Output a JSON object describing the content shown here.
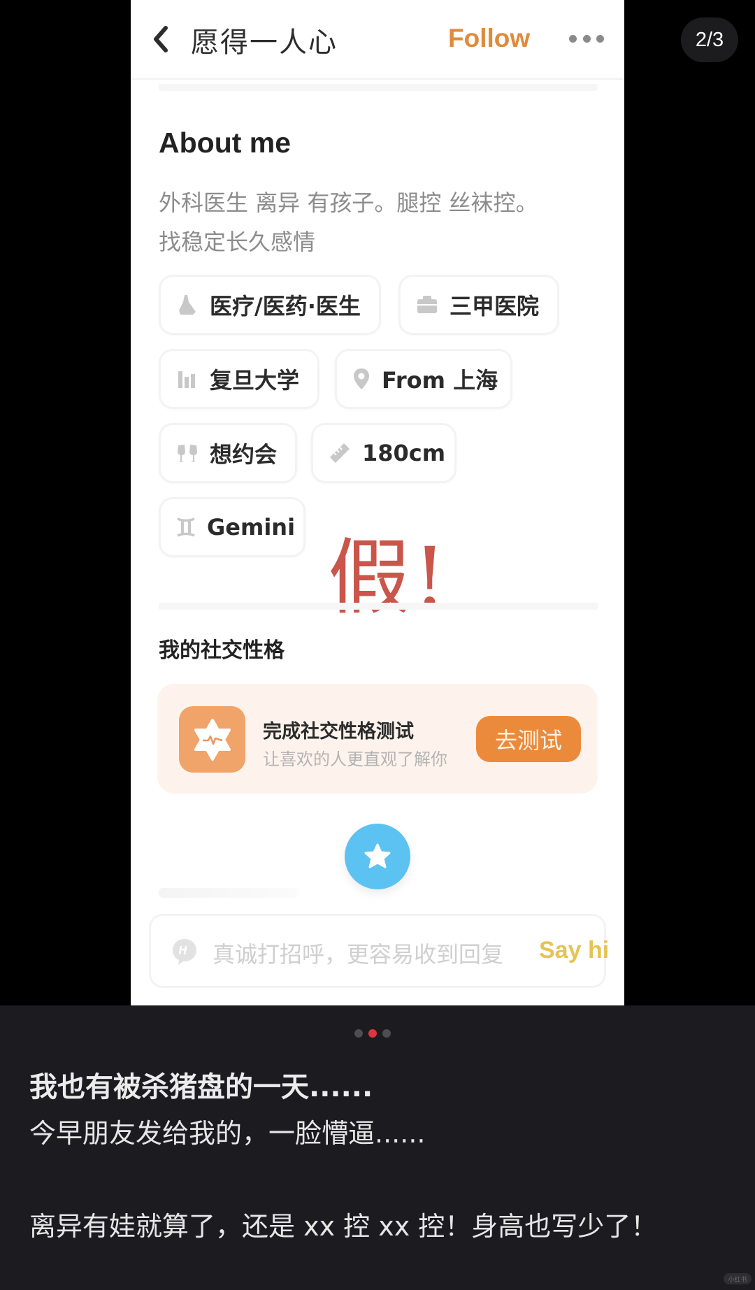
{
  "page_indicator": "2/3",
  "header": {
    "title": "愿得一人心",
    "follow_label": "Follow"
  },
  "about": {
    "heading": "About me",
    "text_line1": "外科医生 离异 有孩子。腿控 丝袜控。",
    "text_line2": "找稳定长久感情"
  },
  "tags": [
    {
      "icon": "industry-icon",
      "label": "医疗/医药·医生"
    },
    {
      "icon": "briefcase-icon",
      "label": "三甲医院"
    },
    {
      "icon": "school-icon",
      "label": "复旦大学"
    },
    {
      "icon": "location-pin-icon",
      "label": "From 上海"
    },
    {
      "icon": "cheers-icon",
      "label": "想约会"
    },
    {
      "icon": "ruler-icon",
      "label": "180cm"
    },
    {
      "icon": "gemini-icon",
      "label": "Gemini"
    }
  ],
  "annotation": "假!",
  "social": {
    "heading": "我的社交性格",
    "card_title": "完成社交性格测试",
    "card_subtitle": "让喜欢的人更直观了解你",
    "button_label": "去测试"
  },
  "message_bar": {
    "placeholder": "真诚打招呼，更容易收到回复",
    "say_hi_label": "Say hi"
  },
  "caption": {
    "carousel_total": 3,
    "carousel_active": 2,
    "title": "我也有被杀猪盘的一天......",
    "line1": "今早朋友发给我的，一脸懵逼......",
    "line2": "离异有娃就算了，还是 xx 控 xx 控！身高也写少了！",
    "watermark": "小红书"
  },
  "colors": {
    "follow": "#e08a3c",
    "annotation": "#c9554b",
    "test_button": "#ec8a3c",
    "fab": "#5cc2f2",
    "say_hi": "#e6c352",
    "active_dot": "#e0343f"
  }
}
